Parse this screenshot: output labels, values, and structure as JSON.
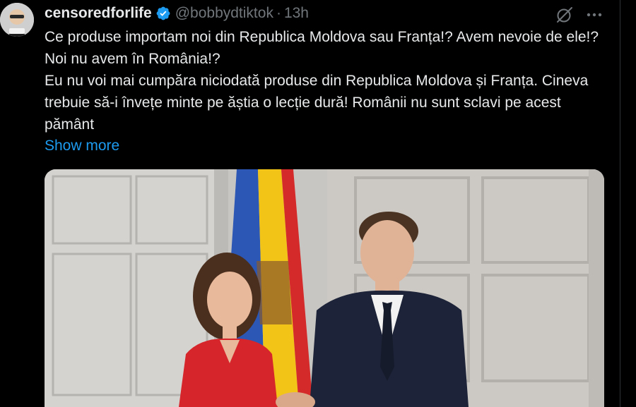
{
  "tweet": {
    "author": {
      "display_name": "censoredforlife",
      "handle": "@bobbydtiktok",
      "verified": true,
      "avatar_icon": "avatar-image"
    },
    "separator": "·",
    "timestamp": "13h",
    "icons": {
      "grok": "grok-slash-circle-icon",
      "more": "more-horizontal-icon",
      "verified": "verified-badge-icon"
    },
    "text_lines": [
      "Ce produse importam noi din Republica Moldova sau Franța!? Avem nevoie de ele!? Noi nu avem în România!?",
      "Eu nu voi mai cumpăra niciodată produse din Republica Moldova și Franța. Cineva trebuie să-i învețe minte pe ăștia o lecție dură! Românii nu sunt sclavi pe acest pământ"
    ],
    "show_more_label": "Show more",
    "colors": {
      "background": "#000000",
      "text": "#e7e9ea",
      "secondary": "#71767b",
      "link": "#1d9bf0",
      "verified": "#1d9bf0"
    }
  }
}
